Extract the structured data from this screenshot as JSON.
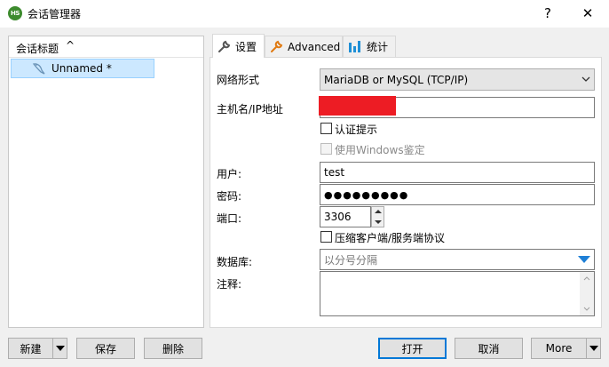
{
  "window": {
    "title": "会话管理器",
    "app_badge": "HS"
  },
  "tree": {
    "header": "会话标题",
    "items": [
      {
        "label": "Unnamed *"
      }
    ]
  },
  "tabs": [
    {
      "label": "设置",
      "icon": "wrench-icon",
      "active": true
    },
    {
      "label": "Advanced",
      "icon": "wrench-orange-icon",
      "active": false
    },
    {
      "label": "统计",
      "icon": "bar-chart-icon",
      "active": false
    }
  ],
  "form": {
    "network_type_label": "网络形式",
    "network_type_value": "MariaDB or MySQL (TCP/IP)",
    "hostname_label": "主机名/IP地址",
    "hostname_value": "",
    "auth_prompt_label": "认证提示",
    "windows_auth_label": "使用Windows鉴定",
    "user_label": "用户:",
    "user_value": "test",
    "password_label": "密码:",
    "password_value": "●●●●●●●●●",
    "port_label": "端口:",
    "port_value": "3306",
    "compress_label": "压缩客户端/服务端协议",
    "database_label": "数据库:",
    "database_placeholder": "以分号分隔",
    "comment_label": "注释:",
    "comment_value": ""
  },
  "buttons": {
    "new": "新建",
    "save": "保存",
    "delete": "删除",
    "open": "打开",
    "cancel": "取消",
    "more": "More"
  },
  "colors": {
    "redaction": "#ed1c24",
    "selection": "#cce8ff",
    "accent": "#0078d7"
  }
}
